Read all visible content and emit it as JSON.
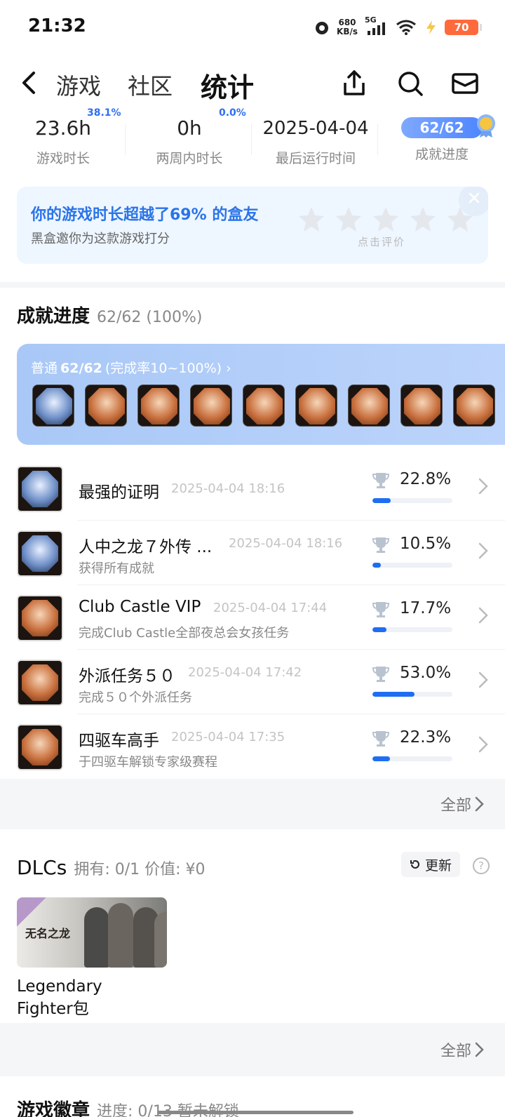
{
  "status": {
    "time": "21:32",
    "net_speed_value": "680",
    "net_speed_unit": "KB/s",
    "network": "5G",
    "battery": "70"
  },
  "nav": {
    "tabs": [
      {
        "label": "游戏"
      },
      {
        "label": "社区"
      },
      {
        "label": "统计"
      }
    ],
    "active_tab": "统计"
  },
  "stats": {
    "playtime": {
      "value": "23.6h",
      "label": "游戏时长",
      "tag": "38.1%"
    },
    "two_weeks": {
      "value": "0h",
      "label": "两周内时长",
      "tag": "0.0%"
    },
    "last_run": {
      "value": "2025-04-04",
      "label": "最后运行时间"
    },
    "achievements": {
      "value": "62/62",
      "label": "成就进度"
    }
  },
  "rating": {
    "title": "你的游戏时长超越了69% 的盒友",
    "subtitle": "黑盒邀你为这款游戏打分",
    "hint": "点击评价",
    "stars": 5
  },
  "achievements": {
    "title": "成就进度",
    "count": "62/62 (100%)",
    "panel_label_prefix": "普通",
    "panel_label_count": "62/62",
    "panel_label_suffix": "(完成率10~100%)",
    "panel_chevron": "›",
    "panel_icons": [
      "blue",
      "orange",
      "orange",
      "orange",
      "orange",
      "orange",
      "orange",
      "orange",
      "orange"
    ],
    "list": [
      {
        "name": "最强的证明",
        "time": "2025-04-04 18:16",
        "desc": "",
        "percent": "22.8%",
        "rate": 0.228,
        "icon": "blue"
      },
      {
        "name": "人中之龙７外传 ...",
        "time": "2025-04-04 18:16",
        "desc": "获得所有成就",
        "percent": "10.5%",
        "rate": 0.105,
        "icon": "blue"
      },
      {
        "name": "Club Castle VIP",
        "time": "2025-04-04 17:44",
        "desc": "完成Club Castle全部夜总会女孩任务",
        "percent": "17.7%",
        "rate": 0.177,
        "icon": "orange"
      },
      {
        "name": "外派任务５０",
        "time": "2025-04-04 17:42",
        "desc": "完成５０个外派任务",
        "percent": "53.0%",
        "rate": 0.53,
        "icon": "orange"
      },
      {
        "name": "四驱车高手",
        "time": "2025-04-04 17:35",
        "desc": "于四驱车解锁专家级赛程",
        "percent": "22.3%",
        "rate": 0.223,
        "icon": "orange"
      }
    ],
    "see_all": "全部"
  },
  "dlc": {
    "title": "DLCs",
    "meta": "拥有: 0/1 价值: ¥0",
    "update_label": "更新",
    "help": "?",
    "item": {
      "cover_title": "无名之龙",
      "name_line1": "Legendary",
      "name_line2": "Fighter包"
    },
    "see_all": "全部"
  },
  "badges": {
    "title": "游戏徽章",
    "meta": "进度: 0/13 暂未解锁"
  },
  "colors": {
    "accent": "#1f6ef2",
    "rating_bg": "#eef6ff",
    "panel_bg": "#a9c8f7",
    "battery": "#ff6a3d"
  }
}
